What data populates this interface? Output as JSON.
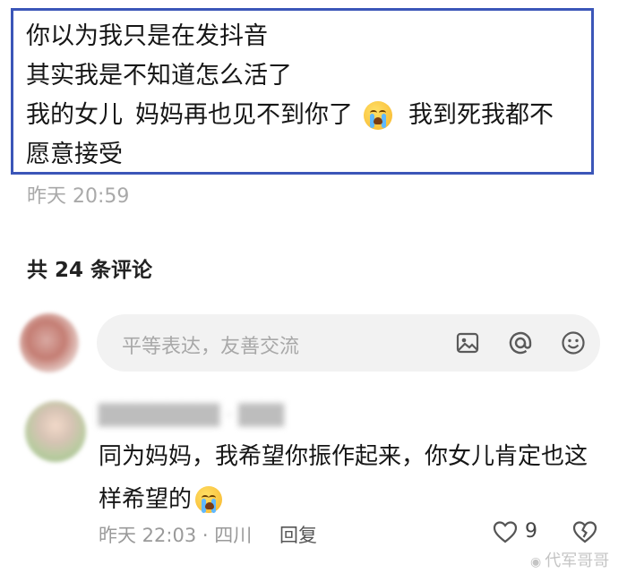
{
  "post": {
    "lines": [
      "你以为我只是在发抖音",
      "其实我是不知道怎么活了"
    ],
    "line3_a": "我的女儿",
    "line3_b": "妈妈再也见不到你了",
    "line3_c": "我到死我都不",
    "line4": "愿意接受",
    "time": "昨天 20:59"
  },
  "comments_header": {
    "count_label": "共 24 条评论"
  },
  "input": {
    "placeholder": "平等表达，友善交流",
    "icons": [
      "image-icon",
      "at-icon",
      "emoji-icon"
    ]
  },
  "comment": {
    "text_line1": "同为妈妈，我希望你振作起来，你女儿肯定也这",
    "text_line2": "样希望的",
    "meta": "昨天 22:03 · 四川",
    "reply_label": "回复",
    "like_count": "9"
  },
  "watermark": "代军哥哥",
  "colors": {
    "highlight_border": "#3b56b8",
    "input_bg": "#f2f2f2"
  }
}
